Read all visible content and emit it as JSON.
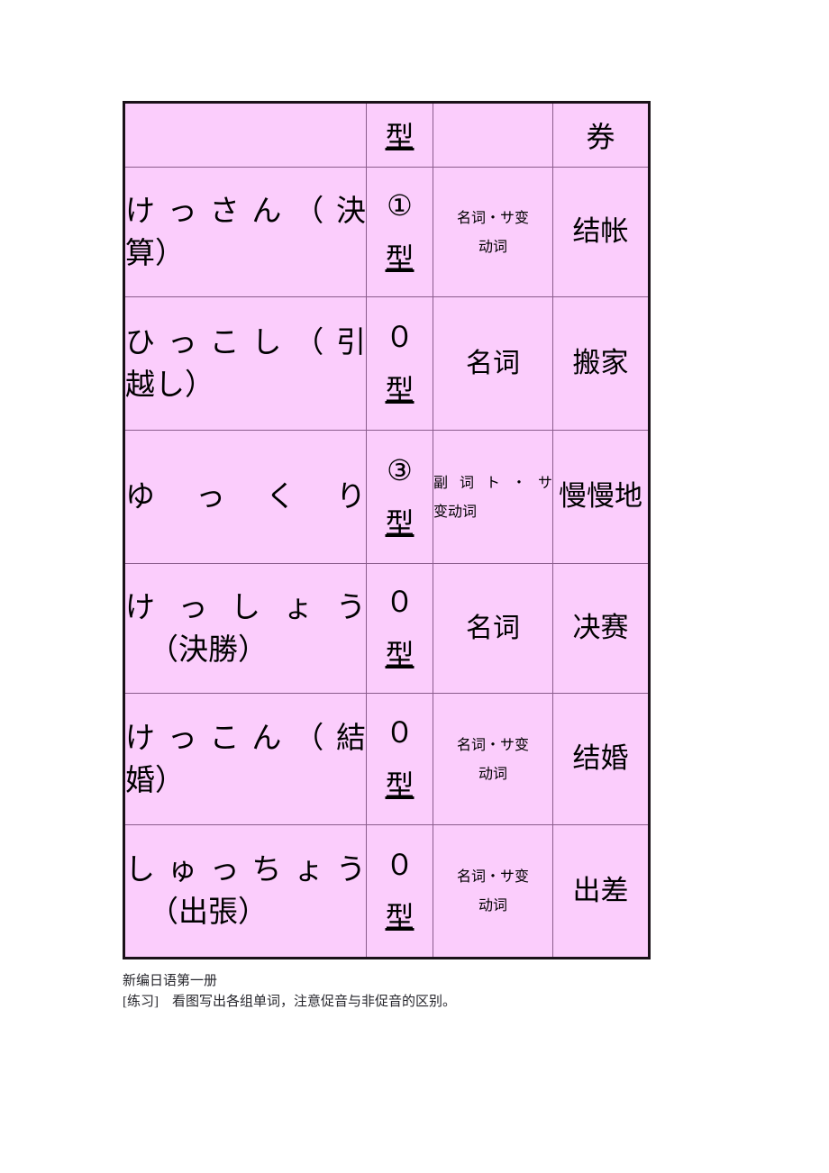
{
  "document": {
    "title": "新编日语第一册 词汇表",
    "accent_color": "#fbcdfc",
    "border_color": "#1a1119",
    "inner_border_color": "#8a5c8c"
  },
  "table": {
    "columns": [
      {
        "key": "word",
        "header": ""
      },
      {
        "key": "type",
        "header": "型"
      },
      {
        "key": "part",
        "header": ""
      },
      {
        "key": "meaning",
        "header": "券"
      }
    ],
    "rows": [
      {
        "word_line1": "けっさん（決",
        "word_line2": "算）",
        "type_number": "①",
        "type_suffix": "型",
        "part_line1": "名词・サ变",
        "part_line2": "动词",
        "part_style": "center",
        "meaning": "结帐"
      },
      {
        "word_line1": "ひっこし（引",
        "word_line2": "越し）",
        "type_number": "０",
        "type_suffix": "型",
        "part_line1": "名词",
        "part_line2": "",
        "part_style": "big",
        "meaning": "搬家"
      },
      {
        "word_line1": "ゆっくり",
        "word_line2": "",
        "type_number": "③",
        "type_suffix": "型",
        "part_line1": "副词ト・サ",
        "part_line2": "变动词",
        "part_style": "justified",
        "meaning": "慢慢地"
      },
      {
        "word_line1": "けっしょう",
        "word_line2": "（決勝）",
        "type_number": "０",
        "type_suffix": "型",
        "part_line1": "名词",
        "part_line2": "",
        "part_style": "big",
        "meaning": "决赛"
      },
      {
        "word_line1": "けっこん（結",
        "word_line2": "婚）",
        "type_number": "０",
        "type_suffix": "型",
        "part_line1": "名词・サ变",
        "part_line2": "动词",
        "part_style": "center",
        "meaning": "结婚"
      },
      {
        "word_line1": "しゅっちょう",
        "word_line2": "（出張）",
        "type_number": "０",
        "type_suffix": "型",
        "part_line1": "名词・サ变",
        "part_line2": "动词",
        "part_style": "center",
        "meaning": "出差"
      }
    ]
  },
  "footer": {
    "book_title": "新编日语第一册",
    "exercise_line": "[练习]    看图写出各组单词，注意促音与非促音的区别。"
  }
}
